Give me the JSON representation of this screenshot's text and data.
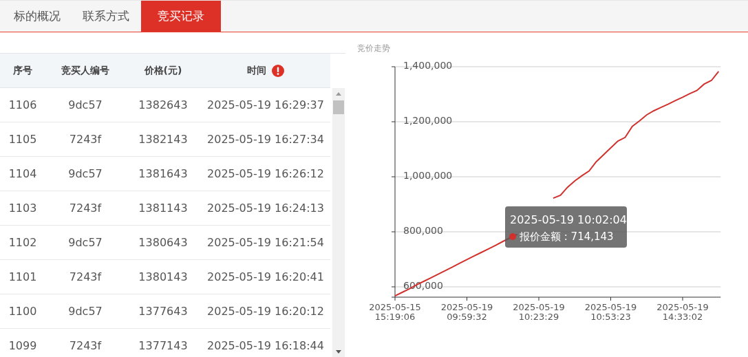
{
  "tabs": [
    {
      "label": "标的概况",
      "selected": false
    },
    {
      "label": "联系方式",
      "selected": false
    },
    {
      "label": "竞买记录",
      "selected": true
    }
  ],
  "table": {
    "columns": [
      "序号",
      "竞买人编号",
      "价格(元)",
      "时间"
    ],
    "rows": [
      [
        "1106",
        "9dc57",
        "1382643",
        "2025-05-19 16:29:37"
      ],
      [
        "1105",
        "7243f",
        "1382143",
        "2025-05-19 16:27:34"
      ],
      [
        "1104",
        "9dc57",
        "1381643",
        "2025-05-19 16:26:12"
      ],
      [
        "1103",
        "7243f",
        "1381143",
        "2025-05-19 16:24:13"
      ],
      [
        "1102",
        "9dc57",
        "1380643",
        "2025-05-19 16:21:54"
      ],
      [
        "1101",
        "7243f",
        "1380143",
        "2025-05-19 16:20:41"
      ],
      [
        "1100",
        "9dc57",
        "1377643",
        "2025-05-19 16:20:12"
      ],
      [
        "1099",
        "7243f",
        "1377143",
        "2025-05-19 16:18:44"
      ]
    ]
  },
  "chart": {
    "chart_data": {
      "type": "line",
      "title": "竞价走势",
      "grid": true,
      "ylim": [
        562500,
        1400000
      ],
      "categories": [
        "2025-05-15 15:19:06",
        null,
        null,
        null,
        null,
        null,
        null,
        null,
        null,
        null,
        "2025-05-19 09:59:32",
        null,
        null,
        null,
        null,
        null,
        null,
        null,
        null,
        null,
        "2025-05-19 10:23:29",
        null,
        null,
        null,
        null,
        null,
        null,
        null,
        null,
        null,
        "2025-05-19 10:53:23",
        null,
        null,
        null,
        null,
        null,
        null,
        null,
        null,
        null,
        "2025-05-19 14:33:02",
        null,
        null,
        null,
        null,
        null
      ],
      "yticks": [
        {
          "value": 600000,
          "label": "600,000"
        },
        {
          "value": 800000,
          "label": "800,000"
        },
        {
          "value": 1000000,
          "label": "1,000,000"
        },
        {
          "value": 1200000,
          "label": "1,200,000"
        },
        {
          "value": 1400000,
          "label": "1,400,000"
        }
      ],
      "series": [
        {
          "name": "报价金额",
          "color": "#d0312d",
          "values": [
            567000,
            580000,
            593000,
            607000,
            620000,
            633000,
            646000,
            659000,
            672000,
            686000,
            699000,
            712000,
            725000,
            738000,
            751000,
            765000,
            778000,
            791000,
            null,
            null,
            null,
            null,
            922000,
            933000,
            962000,
            985000,
            1004000,
            1021000,
            1055000,
            1080000,
            1105000,
            1130000,
            1143000,
            1183000,
            1203000,
            1225000,
            1240000,
            1252000,
            1264000,
            1277000,
            1289000,
            1302000,
            1314000,
            1337000,
            1350000,
            1383000
          ]
        }
      ]
    },
    "tooltip": {
      "time": "2025-05-19 10:02:04",
      "reading": " : 714,143"
    }
  }
}
